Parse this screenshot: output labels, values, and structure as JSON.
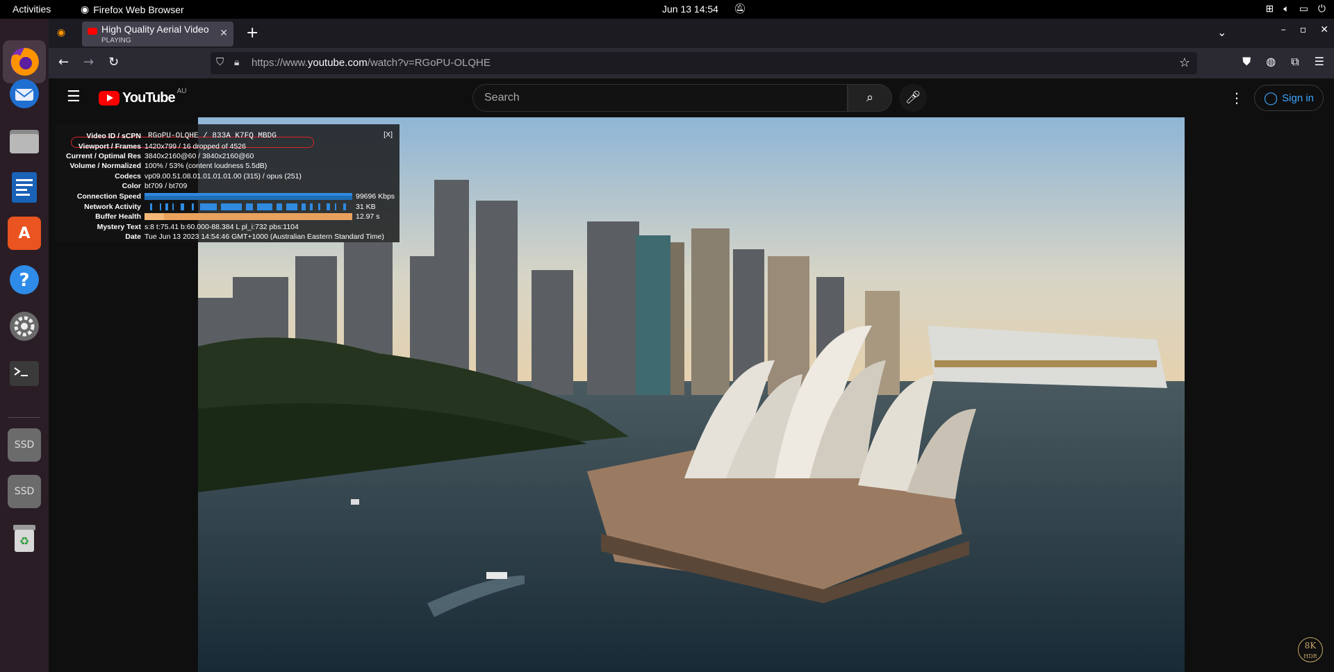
{
  "topbar": {
    "activities": "Activities",
    "app_name": "Firefox Web Browser",
    "clock": "Jun 13  14:54"
  },
  "browser": {
    "tab_title": "High Quality Aerial Video",
    "tab_status": "PLAYING",
    "url_prefix": "https://www.",
    "url_domain": "youtube.com",
    "url_path": "/watch?v=RGoPU-OLQHE"
  },
  "youtube": {
    "logo_text": "YouTube",
    "region": "AU",
    "search_placeholder": "Search",
    "sign_in": "Sign in",
    "badge_top": "8K",
    "badge_bottom": "HDR"
  },
  "stats": {
    "close": "[X]",
    "rows": [
      {
        "label": "Video ID / sCPN",
        "value": "RGoPU-OLQHE / 833A K7FQ MBDG"
      },
      {
        "label": "Viewport / Frames",
        "value": "1420x799 / 16 dropped of 4526"
      },
      {
        "label": "Current / Optimal Res",
        "value": "3840x2160@60 / 3840x2160@60"
      },
      {
        "label": "Volume / Normalized",
        "value": "100% / 53% (content loudness 5.5dB)"
      },
      {
        "label": "Codecs",
        "value": "vp09.00.51.08.01.01.01.01.00 (315) / opus (251)"
      },
      {
        "label": "Color",
        "value": "bt709 / bt709"
      },
      {
        "label": "Connection Speed",
        "value": "99696 Kbps"
      },
      {
        "label": "Network Activity",
        "value": "31 KB"
      },
      {
        "label": "Buffer Health",
        "value": "12.97 s"
      },
      {
        "label": "Mystery Text",
        "value": "s:8 t:75.41 b:60.000-88.384 L pl_i:732 pbs:1104"
      },
      {
        "label": "Date",
        "value": "Tue Jun 13 2023 14:54:46 GMT+1000 (Australian Eastern Standard Time)"
      }
    ]
  }
}
